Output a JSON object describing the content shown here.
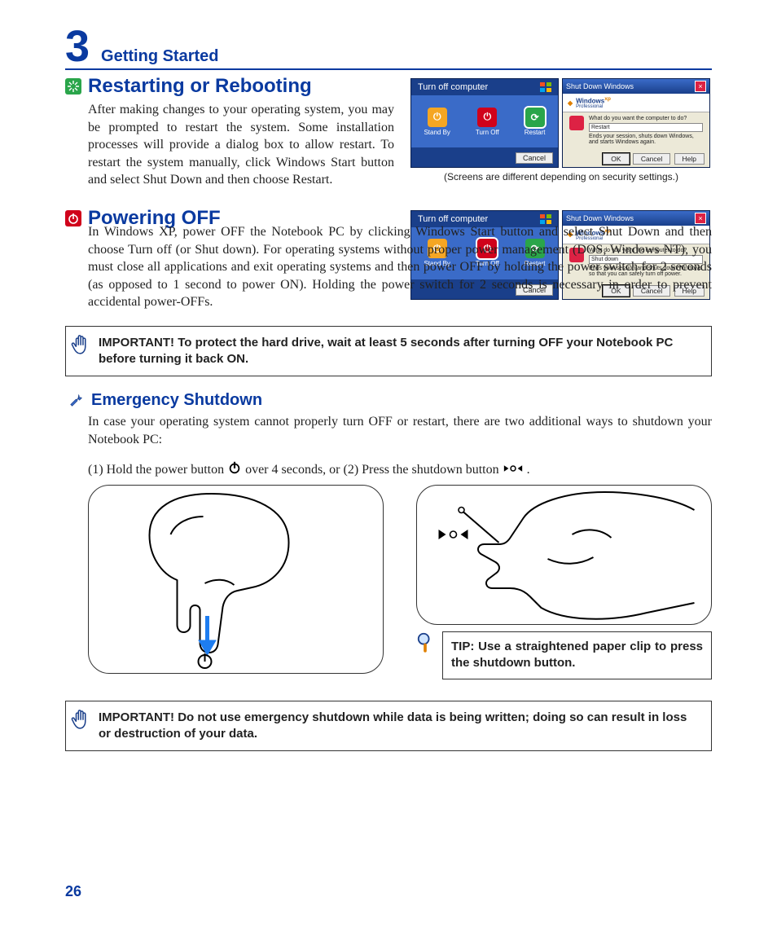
{
  "chapter": {
    "number": "3",
    "title": "Getting Started"
  },
  "sec_restart": {
    "heading": "Restarting or Rebooting",
    "body": "After making changes to your operating system, you may be prompted to restart the system. Some installation processes will provide a dialog box to allow restart. To restart the system manually, click Windows Start button and select Shut Down and then choose Restart.",
    "caption": "(Screens are different depending on security settings.)"
  },
  "sec_poweroff": {
    "heading": "Powering OFF",
    "body": "In Windows XP, power OFF the Notebook PC by clicking Windows Start button and select Shut Down and then choose Turn off (or Shut down). For operating systems without proper power management (DOS, Windows NT), you must close all applications and exit operating systems and then power OFF by holding the power switch for 2 seconds (as opposed to 1 second to power ON). Holding the power switch for 2 seconds is necessary in order to prevent accidental power-OFFs."
  },
  "note_important_hdd": "IMPORTANT!  To protect the hard drive, wait at least 5 seconds after turning OFF your Notebook PC before turning it back ON.",
  "sec_emergency": {
    "heading": "Emergency Shutdown",
    "body": "In case your operating system cannot properly turn OFF or restart, there are two additional ways to shutdown your Notebook PC:",
    "step1_a": "(1) Hold the power button ",
    "step1_b": " over 4 seconds, or  (2) Press the shutdown button ",
    "step1_c": "."
  },
  "tip_text": "TIP: Use a straightened paper clip to press the shutdown button.",
  "note_important_data": "IMPORTANT!  Do not use emergency shutdown while data is being written; doing so can result in loss or destruction of your data.",
  "page_number": "26",
  "xp": {
    "turn_off_title": "Turn off computer",
    "standby": "Stand By",
    "turnoff": "Turn Off",
    "restart": "Restart",
    "cancel": "Cancel",
    "dlg_title": "Shut Down Windows",
    "dlg_brand": "Windows",
    "dlg_brand_sup": "xp",
    "dlg_brand_sub": "Professional",
    "dlg_q": "What do you want the computer to do?",
    "dlg_sel_restart": "Restart",
    "dlg_desc_restart": "Ends your session, shuts down Windows, and starts Windows again.",
    "dlg_sel_shutdown": "Shut down",
    "dlg_desc_shutdown": "Ends your session and shuts down Windows so that you can safely turn off power.",
    "ok": "OK",
    "help": "Help"
  }
}
